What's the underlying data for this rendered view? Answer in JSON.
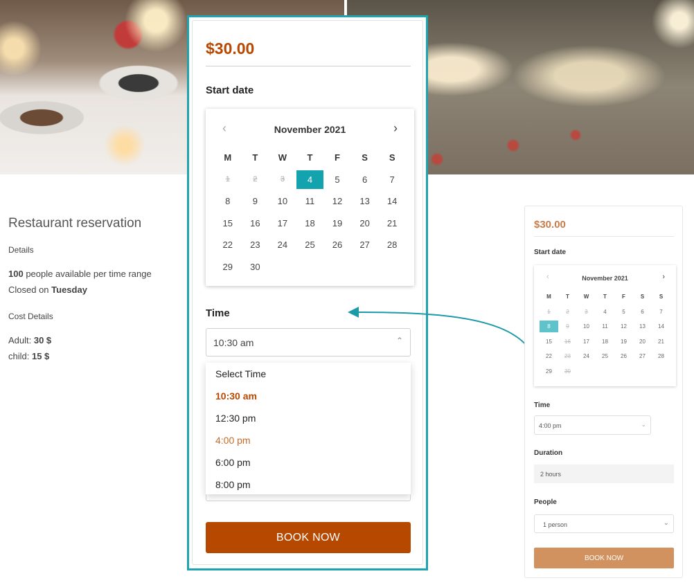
{
  "left_info": {
    "title": "Restaurant reservation",
    "details_heading": "Details",
    "capacity_number": "100",
    "capacity_text": " people available per time range",
    "closed_prefix": "Closed on ",
    "closed_day": "Tuesday",
    "cost_heading": "Cost Details",
    "adult_label": "Adult: ",
    "adult_value": "30 $",
    "child_label": "child: ",
    "child_value": "15 $"
  },
  "widget": {
    "price": "$30.00",
    "start_date_label": "Start date",
    "calendar": {
      "month": "November 2021",
      "prev_icon": "chevron-left-icon",
      "next_icon": "chevron-right-icon",
      "weekdays": [
        "M",
        "T",
        "W",
        "T",
        "F",
        "S",
        "S"
      ],
      "weeks": [
        [
          "1",
          "2",
          "3",
          "4",
          "5",
          "6",
          "7"
        ],
        [
          "8",
          "9",
          "10",
          "11",
          "12",
          "13",
          "14"
        ],
        [
          "15",
          "16",
          "17",
          "18",
          "19",
          "20",
          "21"
        ],
        [
          "22",
          "23",
          "24",
          "25",
          "26",
          "27",
          "28"
        ],
        [
          "29",
          "30",
          "",
          "",
          "",
          "",
          ""
        ]
      ],
      "past_days": [
        "1",
        "2",
        "3"
      ],
      "selected_day": "4"
    },
    "time_label": "Time",
    "time_value": "10:30 am",
    "time_options": [
      "Select Time",
      "10:30 am",
      "12:30 pm",
      "4:00 pm",
      "6:00 pm",
      "8:00 pm"
    ],
    "book_label": "BOOK NOW"
  },
  "mini": {
    "price": "$30.00",
    "start_date_label": "Start date",
    "month": "November 2021",
    "weekdays": [
      "M",
      "T",
      "W",
      "T",
      "F",
      "S",
      "S"
    ],
    "weeks": [
      [
        "1",
        "2",
        "3",
        "4",
        "5",
        "6",
        "7"
      ],
      [
        "8",
        "9",
        "10",
        "11",
        "12",
        "13",
        "14"
      ],
      [
        "15",
        "16",
        "17",
        "18",
        "19",
        "20",
        "21"
      ],
      [
        "22",
        "23",
        "24",
        "25",
        "26",
        "27",
        "28"
      ],
      [
        "29",
        "30",
        "",
        "",
        "",
        "",
        ""
      ]
    ],
    "past_days": [
      "1",
      "2",
      "3",
      "9",
      "16",
      "23",
      "30"
    ],
    "selected_day": "8",
    "time_label": "Time",
    "time_value": "4:00 pm",
    "duration_label": "Duration",
    "duration_value": "2 hours",
    "people_label": "People",
    "people_value": "1 person",
    "book_label": "BOOK NOW"
  },
  "colors": {
    "accent_teal": "#12a3af",
    "price_orange": "#b74800",
    "mini_button": "#d2925f"
  }
}
